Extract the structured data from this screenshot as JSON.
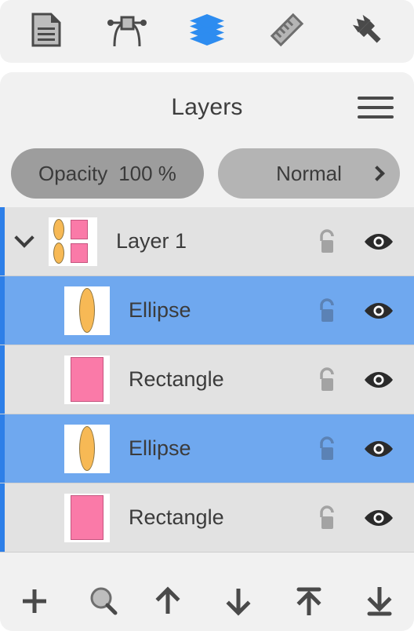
{
  "top_toolbar": {
    "items": [
      {
        "name": "document-icon",
        "label": "Document",
        "active": false
      },
      {
        "name": "node-edit-icon",
        "label": "Node Edit",
        "active": false
      },
      {
        "name": "layers-icon",
        "label": "Layers",
        "active": true
      },
      {
        "name": "ruler-icon",
        "label": "Ruler",
        "active": false
      },
      {
        "name": "brush-icon",
        "label": "Brush",
        "active": false
      }
    ],
    "active_color": "#2d8cf0",
    "inactive_color": "#4a4a4a"
  },
  "panel": {
    "title": "Layers",
    "menu_label": "Menu",
    "opacity_label": "Opacity",
    "opacity_value": "100 %",
    "blend_mode": "Normal",
    "chevron": "chevron-right-icon"
  },
  "layers": [
    {
      "name": "Layer 1",
      "type": "group",
      "selected": false,
      "expanded": true,
      "disclosure": "chevron-down-icon",
      "locked": false,
      "visible": true,
      "lock_label": "Unlocked",
      "visibility_label": "Visible",
      "thumb_shapes": [
        "ellipse",
        "rectangle",
        "ellipse",
        "rectangle"
      ]
    },
    {
      "name": "Ellipse",
      "type": "shape",
      "selected": true,
      "expanded": false,
      "disclosure": "",
      "locked": false,
      "visible": true,
      "lock_label": "Unlocked",
      "visibility_label": "Visible",
      "thumb_shapes": [
        "ellipse"
      ]
    },
    {
      "name": "Rectangle",
      "type": "shape",
      "selected": false,
      "expanded": false,
      "disclosure": "",
      "locked": false,
      "visible": true,
      "lock_label": "Unlocked",
      "visibility_label": "Visible",
      "thumb_shapes": [
        "rectangle"
      ]
    },
    {
      "name": "Ellipse",
      "type": "shape",
      "selected": true,
      "expanded": false,
      "disclosure": "",
      "locked": false,
      "visible": true,
      "lock_label": "Unlocked",
      "visibility_label": "Visible",
      "thumb_shapes": [
        "ellipse"
      ]
    },
    {
      "name": "Rectangle",
      "type": "shape",
      "selected": false,
      "expanded": false,
      "disclosure": "",
      "locked": false,
      "visible": true,
      "lock_label": "Unlocked",
      "visibility_label": "Visible",
      "thumb_shapes": [
        "rectangle"
      ]
    }
  ],
  "bottom_toolbar": {
    "left": [
      {
        "name": "add-layer-icon",
        "label": "Add Layer"
      },
      {
        "name": "search-icon",
        "label": "Search"
      }
    ],
    "right": [
      {
        "name": "move-up-icon",
        "label": "Move Up"
      },
      {
        "name": "move-down-icon",
        "label": "Move Down"
      },
      {
        "name": "move-to-top-icon",
        "label": "Move To Top"
      },
      {
        "name": "move-to-bottom-icon",
        "label": "Move To Bottom"
      }
    ]
  },
  "colors": {
    "selection_blue": "#6fa8ef",
    "accent_blue": "#2d7fe8",
    "row_gray": "#e2e2e2",
    "panel_gray": "#f1f1f1",
    "shape_orange": "#f7b955",
    "shape_pink": "#fa7aa8"
  }
}
